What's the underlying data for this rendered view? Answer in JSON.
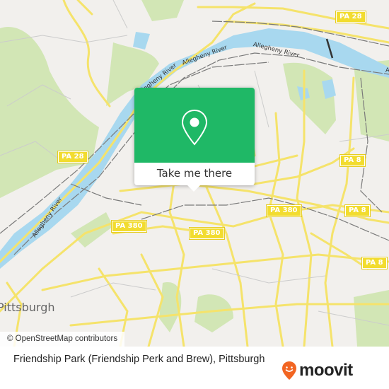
{
  "map": {
    "city_label": "Pittsburgh",
    "river_labels": [
      "Allegheny River",
      "Allegheny River",
      "Allegheny River",
      "Allegheny River",
      "Allegheny River"
    ],
    "route_shields": [
      "PA 28",
      "PA 28",
      "PA 8",
      "PA 8",
      "PA 8",
      "PA 380",
      "PA 380",
      "PA 380"
    ],
    "attribution": "© OpenStreetMap contributors",
    "colors": {
      "land": "#f2f0ed",
      "park": "#cfe5b0",
      "water": "#a8d8ef",
      "road": "#f5e36b",
      "shield": "#f2dc2f",
      "rail": "#777777"
    }
  },
  "popup": {
    "icon": "map-pin-icon",
    "button_label": "Take me there",
    "color": "#1fb866"
  },
  "footer": {
    "place_title": "Friendship Park (Friendship Perk and Brew), Pittsburgh",
    "logo_text": "moovit",
    "logo_icon": "moovit-smile-pin-icon",
    "logo_color": "#f26522"
  }
}
